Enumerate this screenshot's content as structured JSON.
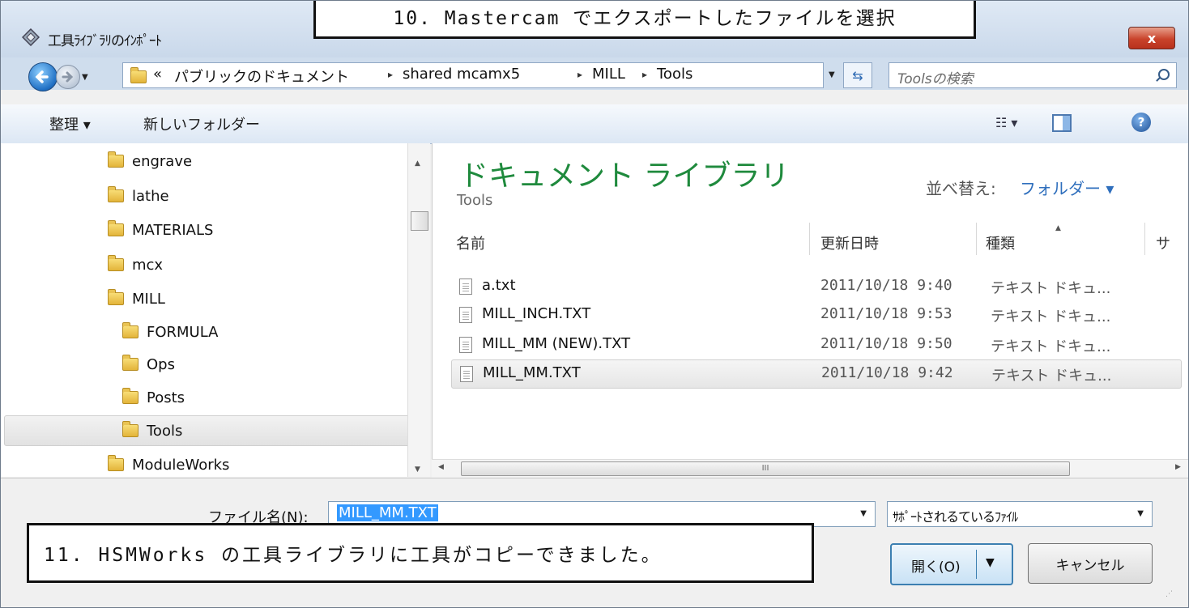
{
  "window": {
    "title": "工具ﾗｲﾌﾞﾗﾘのｲﾝﾎﾟｰﾄ",
    "close_label": "x"
  },
  "callouts": {
    "top": "10. Mastercam でエクスポートしたファイルを選択",
    "bottom": "11. HSMWorks の工具ライブラリに工具がコピーできました。"
  },
  "address": {
    "overflow": "«",
    "crumbs": [
      "パブリックのドキュメント",
      "shared mcamx5",
      "MILL",
      "Tools"
    ],
    "separator": "▸",
    "search_placeholder": "Toolsの検索"
  },
  "toolbar": {
    "organize": "整理 ▾",
    "new_folder": "新しいフォルダー"
  },
  "tree": {
    "items": [
      {
        "label": "engrave"
      },
      {
        "label": "lathe"
      },
      {
        "label": "MATERIALS"
      },
      {
        "label": "mcx"
      },
      {
        "label": "MILL"
      },
      {
        "label": "FORMULA"
      },
      {
        "label": "Ops"
      },
      {
        "label": "Posts"
      },
      {
        "label": "Tools"
      },
      {
        "label": "ModuleWorks"
      }
    ],
    "selected": "Tools"
  },
  "library": {
    "title": "ドキュメント ライブラリ",
    "subtitle": "Tools",
    "sort_label": "並べ替え:",
    "sort_value": "フォルダー ▾"
  },
  "columns": {
    "name": "名前",
    "date": "更新日時",
    "type": "種類",
    "size": "サ"
  },
  "files": [
    {
      "name": "a.txt",
      "date": "2011/10/18 9:40",
      "type": "テキスト ドキュ..."
    },
    {
      "name": "MILL_INCH.TXT",
      "date": "2011/10/18 9:53",
      "type": "テキスト ドキュ..."
    },
    {
      "name": "MILL_MM (NEW).TXT",
      "date": "2011/10/18 9:50",
      "type": "テキスト ドキュ..."
    },
    {
      "name": "MILL_MM.TXT",
      "date": "2011/10/18 9:42",
      "type": "テキスト ドキュ..."
    }
  ],
  "selected_file": "MILL_MM.TXT",
  "scroll": {
    "grip": "III"
  },
  "bottom": {
    "filename_label": "ファイル名(N):",
    "filename_value": "MILL_MM.TXT",
    "filetype_value": "ｻﾎﾟｰﾄされるているﾌｧｲﾙ",
    "open_label": "開く(O)",
    "cancel_label": "キャンセル"
  },
  "colors": {
    "library_title": "#1f8a3d",
    "sort_value": "#2f6fbd",
    "selection": "#3399ff",
    "close_button": "#c9432b"
  }
}
